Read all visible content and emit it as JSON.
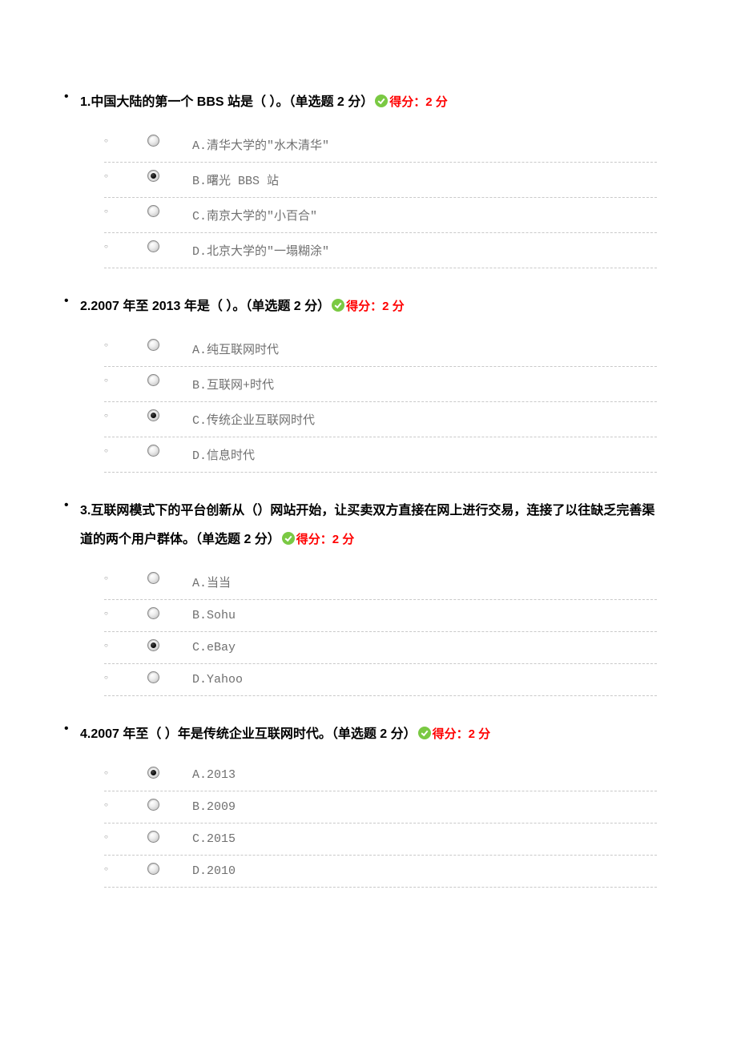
{
  "score_label": "得分：2 分",
  "questions": [
    {
      "num": "1.",
      "text": "中国大陆的第一个 BBS 站是（ ）。（单选题 2 分）",
      "selected": 1,
      "options": [
        "A.清华大学的\"水木清华\"",
        "B.曙光 BBS 站",
        "C.南京大学的\"小百合\"",
        "D.北京大学的\"一塌糊涂\""
      ]
    },
    {
      "num": "2.",
      "text": "2007 年至 2013 年是（ ）。（单选题 2 分）",
      "selected": 2,
      "options": [
        "A.纯互联网时代",
        "B.互联网+时代",
        "C.传统企业互联网时代",
        "D.信息时代"
      ]
    },
    {
      "num": "3.",
      "text": "互联网模式下的平台创新从（）网站开始，让买卖双方直接在网上进行交易，连接了以往缺乏完善渠道的两个用户群体。（单选题 2 分）",
      "selected": 2,
      "options": [
        "A.当当",
        "B.Sohu",
        "C.eBay",
        "D.Yahoo"
      ]
    },
    {
      "num": "4.",
      "text": "2007 年至（ ）年是传统企业互联网时代。（单选题 2 分）",
      "selected": 0,
      "options": [
        "A.2013",
        "B.2009",
        "C.2015",
        "D.2010"
      ]
    }
  ]
}
